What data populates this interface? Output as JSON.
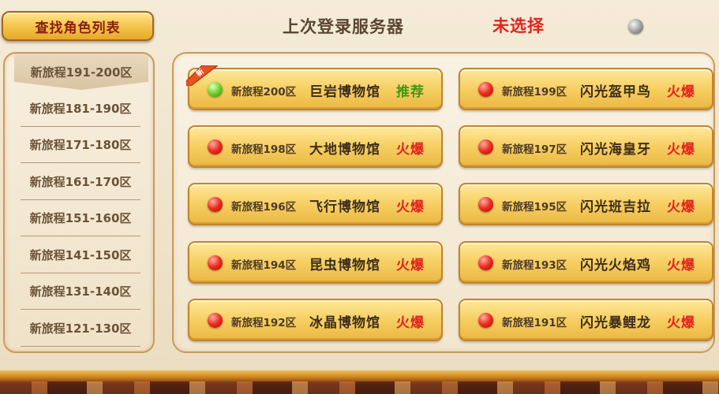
{
  "header": {
    "find_role_list": "查找角色列表",
    "last_login_label": "上次登录服务器",
    "last_login_value": "未选择"
  },
  "regions": [
    {
      "label": "新旅程191-200区",
      "active": true
    },
    {
      "label": "新旅程181-190区",
      "active": false
    },
    {
      "label": "新旅程171-180区",
      "active": false
    },
    {
      "label": "新旅程161-170区",
      "active": false
    },
    {
      "label": "新旅程151-160区",
      "active": false
    },
    {
      "label": "新旅程141-150区",
      "active": false
    },
    {
      "label": "新旅程131-140区",
      "active": false
    },
    {
      "label": "新旅程121-130区",
      "active": false
    }
  ],
  "servers": [
    {
      "zone": "新旅程200区",
      "name": "巨岩博物馆",
      "status": "推荐",
      "dot": "green",
      "is_new": true
    },
    {
      "zone": "新旅程199区",
      "name": "闪光盔甲鸟",
      "status": "火爆",
      "dot": "red",
      "is_new": false
    },
    {
      "zone": "新旅程198区",
      "name": "大地博物馆",
      "status": "火爆",
      "dot": "red",
      "is_new": false
    },
    {
      "zone": "新旅程197区",
      "name": "闪光海皇牙",
      "status": "火爆",
      "dot": "red",
      "is_new": false
    },
    {
      "zone": "新旅程196区",
      "name": "飞行博物馆",
      "status": "火爆",
      "dot": "red",
      "is_new": false
    },
    {
      "zone": "新旅程195区",
      "name": "闪光班吉拉",
      "status": "火爆",
      "dot": "red",
      "is_new": false
    },
    {
      "zone": "新旅程194区",
      "name": "昆虫博物馆",
      "status": "火爆",
      "dot": "red",
      "is_new": false
    },
    {
      "zone": "新旅程193区",
      "name": "闪光火焰鸡",
      "status": "火爆",
      "dot": "red",
      "is_new": false
    },
    {
      "zone": "新旅程192区",
      "name": "冰晶博物馆",
      "status": "火爆",
      "dot": "red",
      "is_new": false
    },
    {
      "zone": "新旅程191区",
      "name": "闪光暴鲤龙",
      "status": "火爆",
      "dot": "red",
      "is_new": false
    }
  ],
  "new_badge_text": "新",
  "colors": {
    "hot": "#e2231d",
    "recommended": "#3f9a14",
    "button_gold": "#f6cf62",
    "title_red": "#8a1e0c"
  }
}
